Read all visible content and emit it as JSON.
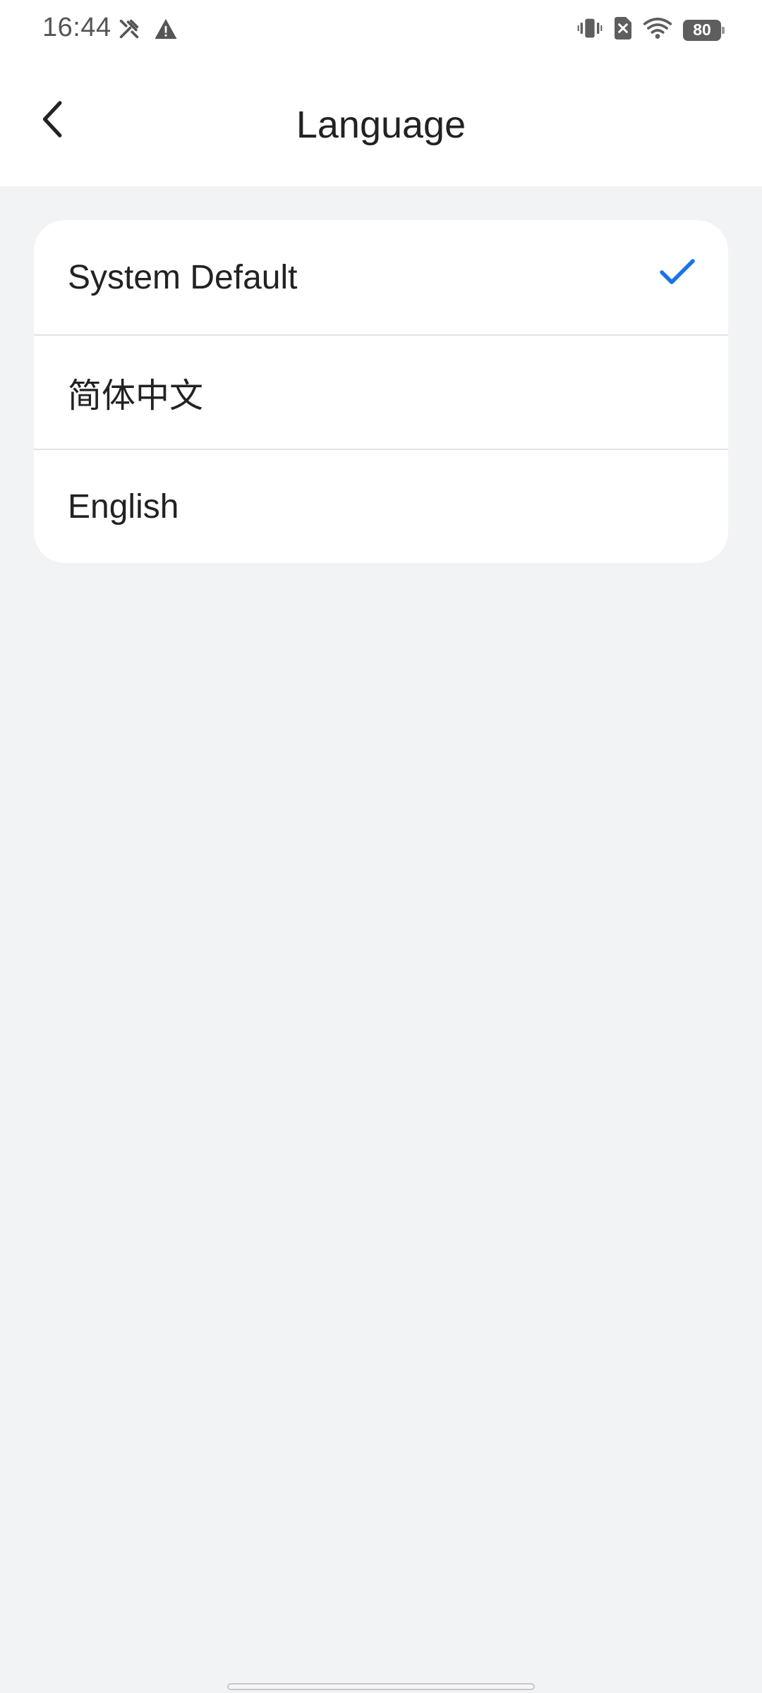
{
  "status_bar": {
    "time": "16:44",
    "left_icons": [
      "tools-icon",
      "warning-icon"
    ],
    "right_icons": [
      "vibrate-icon",
      "no-sim-icon",
      "wifi-icon"
    ],
    "battery_level": "80"
  },
  "app_bar": {
    "title": "Language",
    "back_icon": "chevron-left-icon"
  },
  "languages": {
    "items": [
      {
        "label": "System Default",
        "selected": true
      },
      {
        "label": "简体中文",
        "selected": false
      },
      {
        "label": "English",
        "selected": false
      }
    ],
    "check_icon": "checkmark-icon"
  },
  "colors": {
    "accent": "#1a73e8",
    "background": "#f2f3f5",
    "surface": "#ffffff",
    "text_primary": "#222222",
    "divider": "#e3e3e5"
  }
}
